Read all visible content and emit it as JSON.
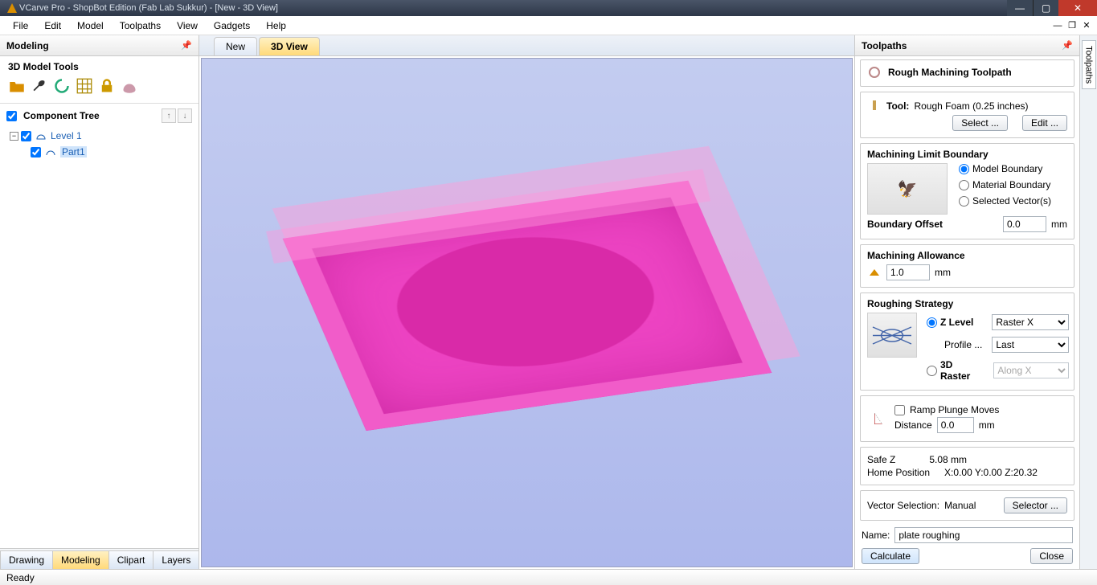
{
  "window": {
    "title": "VCarve Pro - ShopBot Edition (Fab Lab Sukkur) - [New - 3D View]"
  },
  "menu": {
    "items": [
      "File",
      "Edit",
      "Model",
      "Toolpaths",
      "View",
      "Gadgets",
      "Help"
    ]
  },
  "left_panel": {
    "header": "Modeling",
    "section_title": "3D Model Tools",
    "tree_header": "Component Tree",
    "tree": {
      "root": "Level 1",
      "child": "Part1"
    },
    "bottom_tabs": [
      "Drawing",
      "Modeling",
      "Clipart",
      "Layers"
    ],
    "active_bottom_tab": "Modeling"
  },
  "center": {
    "tabs": [
      "New",
      "3D View"
    ],
    "active_tab": "3D View"
  },
  "right_panel": {
    "header": "Toolpaths",
    "title": "Rough Machining Toolpath",
    "tool_label": "Tool:",
    "tool_value": "Rough Foam (0.25 inches)",
    "select_btn": "Select ...",
    "edit_btn": "Edit ...",
    "limit_boundary": {
      "title": "Machining Limit Boundary",
      "opts": [
        "Model Boundary",
        "Material Boundary",
        "Selected Vector(s)"
      ],
      "selected": "Model Boundary",
      "offset_label": "Boundary Offset",
      "offset_value": "0.0",
      "offset_unit": "mm"
    },
    "allowance": {
      "title": "Machining Allowance",
      "value": "1.0",
      "unit": "mm"
    },
    "strategy": {
      "title": "Roughing Strategy",
      "zlevel_label": "Z Level",
      "zlevel_opt": "Raster X",
      "profile_label": "Profile ...",
      "profile_opt": "Last",
      "raster3d_label": "3D Raster",
      "raster3d_opt": "Along X"
    },
    "ramp": {
      "label": "Ramp Plunge Moves",
      "dist_label": "Distance",
      "dist_value": "0.0",
      "dist_unit": "mm"
    },
    "safez_label": "Safe Z",
    "safez_value": "5.08 mm",
    "home_label": "Home Position",
    "home_value": "X:0.00 Y:0.00 Z:20.32",
    "vecsel_label": "Vector Selection:",
    "vecsel_value": "Manual",
    "selector_btn": "Selector ...",
    "name_label": "Name:",
    "name_value": "plate roughing",
    "calculate_btn": "Calculate",
    "close_btn": "Close"
  },
  "gutter": {
    "tab": "Toolpaths"
  },
  "status": {
    "text": "Ready"
  }
}
